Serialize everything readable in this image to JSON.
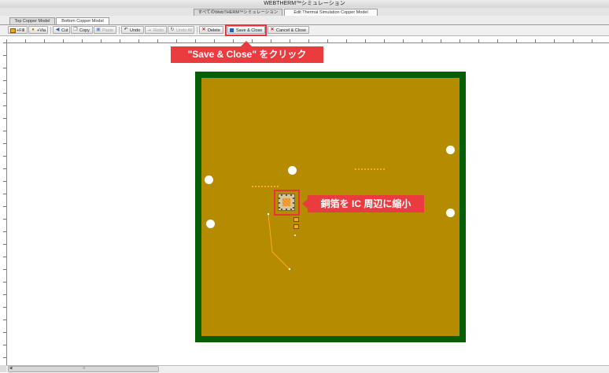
{
  "window": {
    "title": "WEBTHERM™シミュレーション"
  },
  "top_tabs": [
    {
      "label": "すべてのWebTHERM™シミュレーション",
      "active": false
    },
    {
      "label": "Edit Thermal Simulation Copper Model",
      "active": true
    }
  ],
  "model_tabs": [
    {
      "label": "Top Copper Model",
      "active": false
    },
    {
      "label": "Bottom Copper Model",
      "active": true
    }
  ],
  "toolbar": {
    "fill_label": "+Fill",
    "via_label": "+Via",
    "cut_label": "Cut",
    "copy_label": "Copy",
    "paste_label": "Paste",
    "undo_label": "Undo",
    "redo_label": "Redo",
    "undoall_label": "Undo All",
    "delete_label": "Delete",
    "saveclose_label": "Save & Close",
    "cancelclose_label": "Cancel & Close"
  },
  "annotations": {
    "save_callout": "\"Save & Close\" をクリック",
    "shrink_callout": "銅箔を IC 周辺に縮小"
  },
  "colors": {
    "board_frame": "#065f04",
    "copper": "#b58c00",
    "callout": "#ea3b3f",
    "trace": "#ffa726"
  },
  "icons": [
    "fill-icon",
    "via-icon",
    "cut-icon",
    "copy-icon",
    "paste-icon",
    "undo-icon",
    "redo-icon",
    "undo-all-icon",
    "delete-icon",
    "save-icon",
    "cancel-icon",
    "scroll-left-icon"
  ]
}
